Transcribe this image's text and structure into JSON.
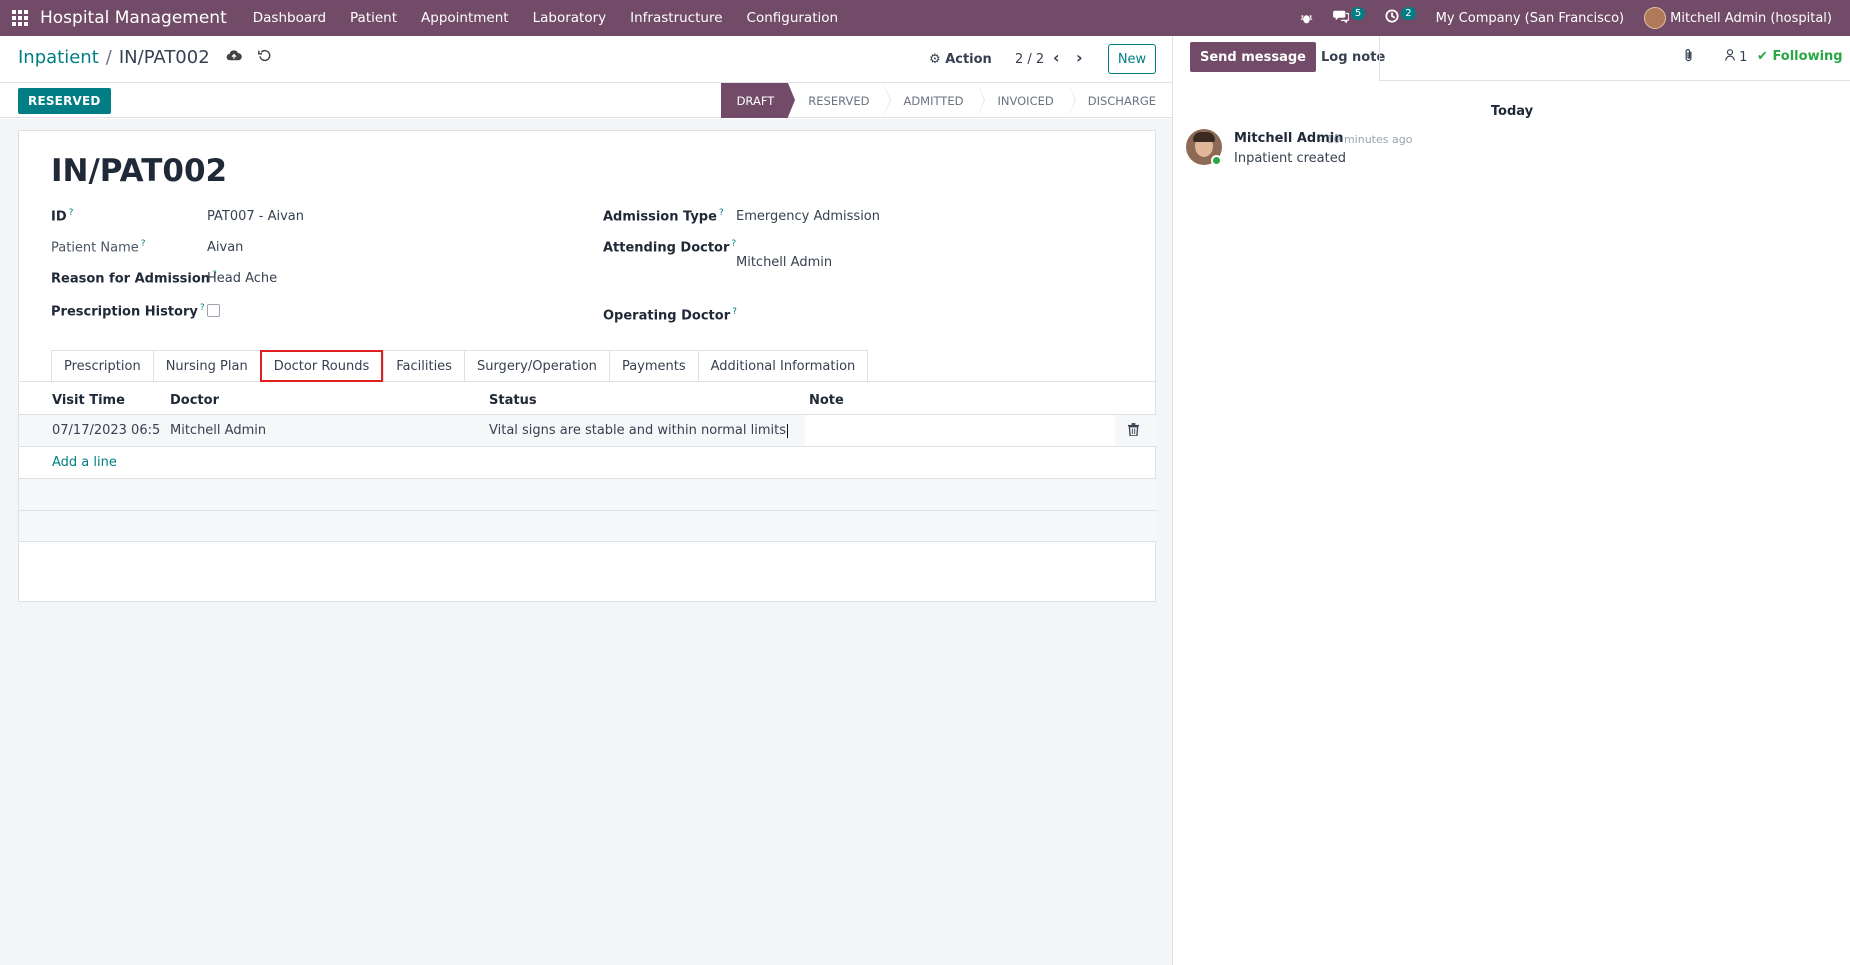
{
  "navbar": {
    "app_name": "Hospital Management",
    "menu": [
      "Dashboard",
      "Patient",
      "Appointment",
      "Laboratory",
      "Infrastructure",
      "Configuration"
    ],
    "messages_count": "5",
    "activities_count": "2",
    "company": "My Company (San Francisco)",
    "user": "Mitchell Admin (hospital)"
  },
  "breadcrumb": {
    "parent": "Inpatient",
    "current": "IN/PAT002"
  },
  "control": {
    "action_label": "Action",
    "pager": "2 / 2",
    "new_label": "New"
  },
  "status": {
    "button_label": "RESERVED",
    "stages": [
      "DRAFT",
      "RESERVED",
      "ADMITTED",
      "INVOICED",
      "DISCHARGE"
    ],
    "active_stage": "DRAFT"
  },
  "form": {
    "title": "IN/PAT002",
    "id_label": "ID",
    "id_value": "PAT007 - Aivan",
    "patient_name_label": "Patient Name",
    "patient_name_value": "Aivan",
    "reason_label": "Reason for Admission",
    "reason_value": "Head Ache",
    "prescription_history_label": "Prescription History",
    "admission_type_label": "Admission Type",
    "admission_type_value": "Emergency Admission",
    "attending_doctor_label": "Attending Doctor",
    "attending_doctor_value": "Mitchell Admin",
    "operating_doctor_label": "Operating Doctor",
    "help_mark": "?"
  },
  "tabs": [
    "Prescription",
    "Nursing Plan",
    "Doctor Rounds",
    "Facilities",
    "Surgery/Operation",
    "Payments",
    "Additional Information"
  ],
  "active_tab": "Doctor Rounds",
  "rounds_table": {
    "headers": [
      "Visit Time",
      "Doctor",
      "Status",
      "Note"
    ],
    "rows": [
      {
        "visit_time": "07/17/2023 06:5",
        "doctor": "Mitchell Admin",
        "status": "Vital signs are stable and within normal limits",
        "note": ""
      }
    ],
    "add_line": "Add a line"
  },
  "chatter": {
    "send_message": "Send message",
    "log_note": "Log note",
    "followers_count": "1",
    "following_label": "Following",
    "date_separator": "Today",
    "messages": [
      {
        "author": "Mitchell Admin",
        "time": "- 10 minutes ago",
        "body": "Inpatient created"
      }
    ]
  },
  "colors": {
    "brand": "#714B67",
    "accent": "#017e84",
    "highlight_border": "#e02020",
    "following": "#28a745"
  }
}
